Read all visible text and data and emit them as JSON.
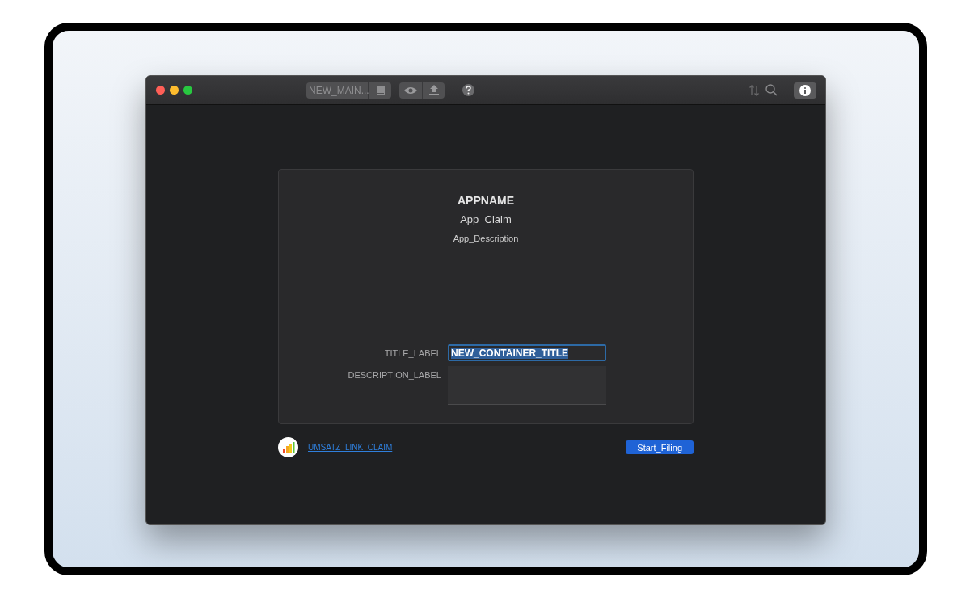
{
  "window": {
    "toolbar": {
      "document_field": "NEW_MAIN..."
    }
  },
  "card": {
    "app_name": "APPNAME",
    "claim": "App_Claim",
    "description": "App_Description",
    "fields": [
      {
        "kind": "text",
        "label": "TITLE_LABEL",
        "value": "NEW_CONTAINER_TITLE",
        "focused": true
      },
      {
        "kind": "area",
        "label": "DESCRIPTION_LABEL",
        "focused": false
      }
    ]
  },
  "footer": {
    "link": "UMSATZ_LINK_CLAIM",
    "button": "Start_Filing"
  }
}
